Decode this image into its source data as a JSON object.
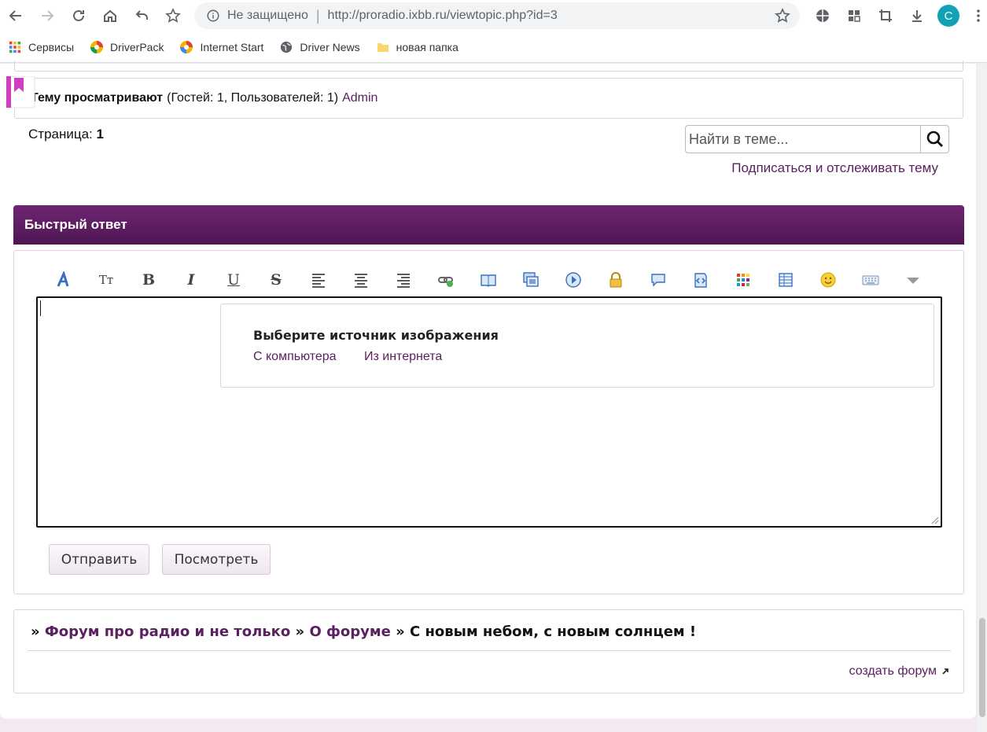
{
  "browser": {
    "security_label": "Не защищено",
    "separator": "|",
    "url": "http://proradio.ixbb.ru/viewtopic.php?id=3",
    "profile_initial": "C"
  },
  "bookmarks": [
    {
      "label": "Сервисы",
      "icon": "apps-grid-icon"
    },
    {
      "label": "DriverPack",
      "icon": "driverpack-icon"
    },
    {
      "label": "Internet Start",
      "icon": "internet-start-icon"
    },
    {
      "label": "Driver News",
      "icon": "globe-icon"
    },
    {
      "label": "новая папка",
      "icon": "folder-icon"
    }
  ],
  "viewers": {
    "label": "Тему просматривают",
    "counts": "(Гостей: 1, Пользователей: 1)",
    "user": "Admin"
  },
  "pagination": {
    "label": "Страница:",
    "current": "1"
  },
  "search": {
    "placeholder": "Найти в теме..."
  },
  "subscribe_link": "Подписаться и отслеживать тему",
  "quick_reply": {
    "title": "Быстрый ответ",
    "image_popup": {
      "title": "Выберите источник изображения",
      "option_computer": "С компьютера",
      "option_internet": "Из интернета"
    },
    "submit_label": "Отправить",
    "preview_label": "Посмотреть"
  },
  "footer": {
    "crumb_prefix": "»",
    "crumb_forum": "Форум про радио и не только",
    "crumb_sep": "»",
    "crumb_section": "О форуме",
    "crumb_sep2": "»",
    "crumb_topic": "С новым небом, с новым солнцем !",
    "create_forum": "создать форум"
  },
  "colors": {
    "accent": "#5a2060",
    "header_bg": "#6e2672",
    "border": "#e0cfe0"
  }
}
